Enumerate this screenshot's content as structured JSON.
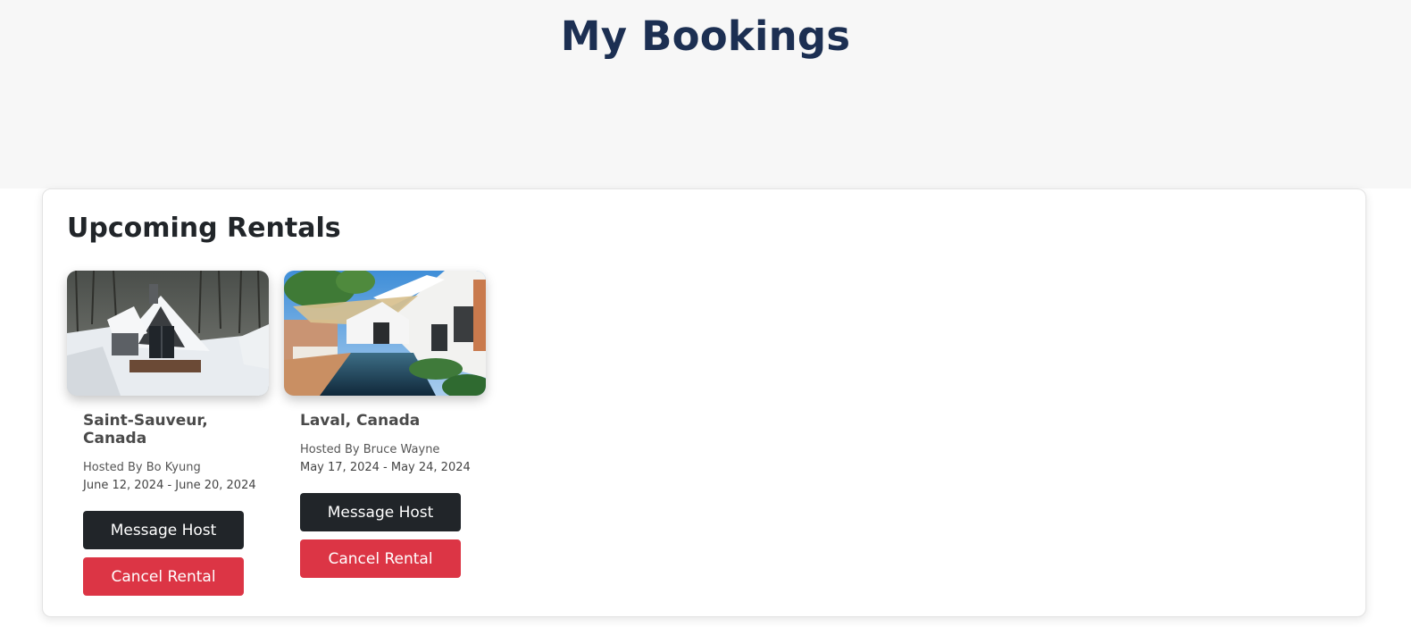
{
  "page": {
    "title": "My Bookings"
  },
  "upcoming": {
    "heading": "Upcoming Rentals",
    "rentals": [
      {
        "location": "Saint-Sauveur, Canada",
        "host": "Hosted By Bo Kyung",
        "dates": "June 12, 2024 - June 20, 2024",
        "image": "snowy-chalet-photo",
        "message_label": "Message Host",
        "cancel_label": "Cancel Rental"
      },
      {
        "location": "Laval, Canada",
        "host": "Hosted By Bruce Wayne",
        "dates": "May 17, 2024 - May 24, 2024",
        "image": "pool-house-photo",
        "message_label": "Message Host",
        "cancel_label": "Cancel Rental"
      }
    ]
  },
  "colors": {
    "title": "#1c2f52",
    "message_button": "#212529",
    "cancel_button": "#dc3545",
    "header_band": "#f7f7f7"
  }
}
